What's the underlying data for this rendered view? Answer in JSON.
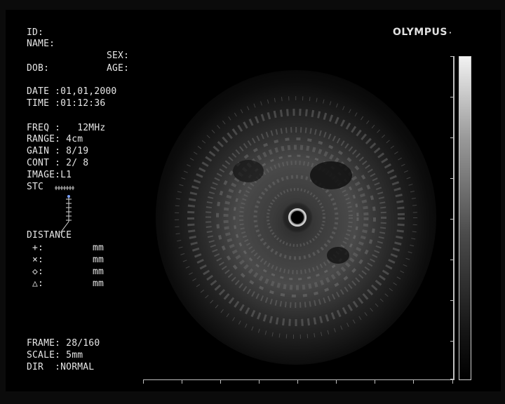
{
  "patient": {
    "id_label": "ID:",
    "name_label": "NAME:",
    "sex_label": "SEX:",
    "dob_label": "DOB:",
    "age_label": "AGE:"
  },
  "study": {
    "date": "DATE :01,01,2000",
    "time": "TIME :01:12:36"
  },
  "settings": {
    "freq": "FREQ :   12MHz",
    "range": "RANGE: 4cm",
    "gain": "GAIN : 8/19",
    "cont": "CONT : 2/ 8",
    "image": "IMAGE:L1",
    "stc": "STC"
  },
  "distance": {
    "title": "DISTANCE",
    "rows": [
      {
        "symbol": "+:",
        "unit": "mm"
      },
      {
        "symbol": "×:",
        "unit": "mm"
      },
      {
        "symbol": "◇:",
        "unit": "mm"
      },
      {
        "symbol": "△:",
        "unit": "mm"
      }
    ]
  },
  "footer": {
    "frame": "FRAME: 28/160",
    "scale": "SCALE: 5mm",
    "dir": "DIR  :NORMAL"
  },
  "brand": {
    "logo": "OLYMPUS",
    "dot": "·"
  },
  "colors": {
    "text": "#e6e6e6",
    "background": "#000000",
    "stc_marker": "#7aa0ff"
  },
  "icons": {
    "stc_curve": "stc-curve-icon",
    "gray_bar": "grayscale-bar"
  }
}
